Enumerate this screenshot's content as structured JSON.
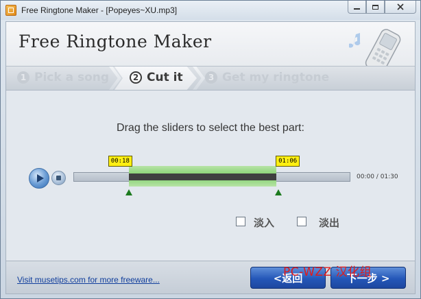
{
  "window": {
    "title": "Free Ringtone Maker - [Popeyes~XU.mp3]"
  },
  "header": {
    "app_title": "Free Ringtone Maker"
  },
  "steps": [
    {
      "number": "1",
      "label": "Pick a song",
      "state": "inactive"
    },
    {
      "number": "2",
      "label": "Cut it",
      "state": "active"
    },
    {
      "number": "3",
      "label": "Get my ringtone",
      "state": "inactive"
    }
  ],
  "editor": {
    "instruction": "Drag the sliders to select the best part:",
    "start_marker": "00:18",
    "end_marker": "01:06",
    "time_readout": "00:00 / 01:30",
    "selection_start_fraction": 0.2,
    "selection_end_fraction": 0.733,
    "fade_in_label": "淡入",
    "fade_out_label": "淡出",
    "fade_in_checked": false,
    "fade_out_checked": false
  },
  "footer": {
    "link_text": "Visit musetips.com for more freeware...",
    "back_label": "<返回",
    "next_label": "下一步 >",
    "watermark": "PC-WZZ 汉化组"
  },
  "colors": {
    "selection_green": "#7fcf69",
    "marker_yellow": "#ffef12",
    "nav_button_blue": "#2457b8",
    "link_blue": "#103e9c",
    "watermark_red": "#e01b1b"
  },
  "icons": [
    "app-icon",
    "minimize-icon",
    "maximize-icon",
    "close-icon",
    "phone-music-icon",
    "play-icon",
    "stop-icon"
  ]
}
